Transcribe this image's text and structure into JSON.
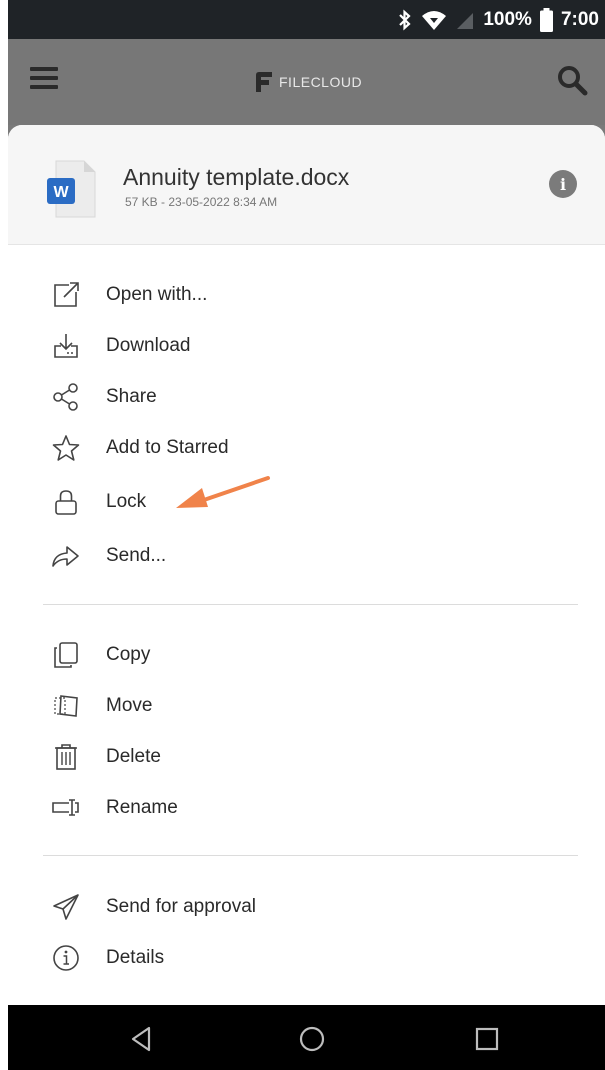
{
  "status_bar": {
    "battery": "100%",
    "time": "7:00"
  },
  "app_bar": {
    "brand": "FILECLOUD"
  },
  "file": {
    "name": "Annuity template.docx",
    "meta": "57 KB - 23-05-2022 8:34 AM",
    "type_letter": "W"
  },
  "menu": {
    "group1": [
      {
        "label": "Open with...",
        "icon": "open-with-icon"
      },
      {
        "label": "Download",
        "icon": "download-icon"
      },
      {
        "label": "Share",
        "icon": "share-icon"
      },
      {
        "label": "Add to Starred",
        "icon": "star-icon"
      },
      {
        "label": "Lock",
        "icon": "lock-icon"
      },
      {
        "label": "Send...",
        "icon": "send-icon"
      }
    ],
    "group2": [
      {
        "label": "Copy",
        "icon": "copy-icon"
      },
      {
        "label": "Move",
        "icon": "move-icon"
      },
      {
        "label": "Delete",
        "icon": "trash-icon"
      },
      {
        "label": "Rename",
        "icon": "rename-icon"
      }
    ],
    "group3": [
      {
        "label": "Send for approval",
        "icon": "paper-plane-icon"
      },
      {
        "label": "Details",
        "icon": "info-icon"
      }
    ]
  },
  "colors": {
    "annotation_arrow": "#f0834a",
    "word_blue": "#2b6cc4"
  }
}
